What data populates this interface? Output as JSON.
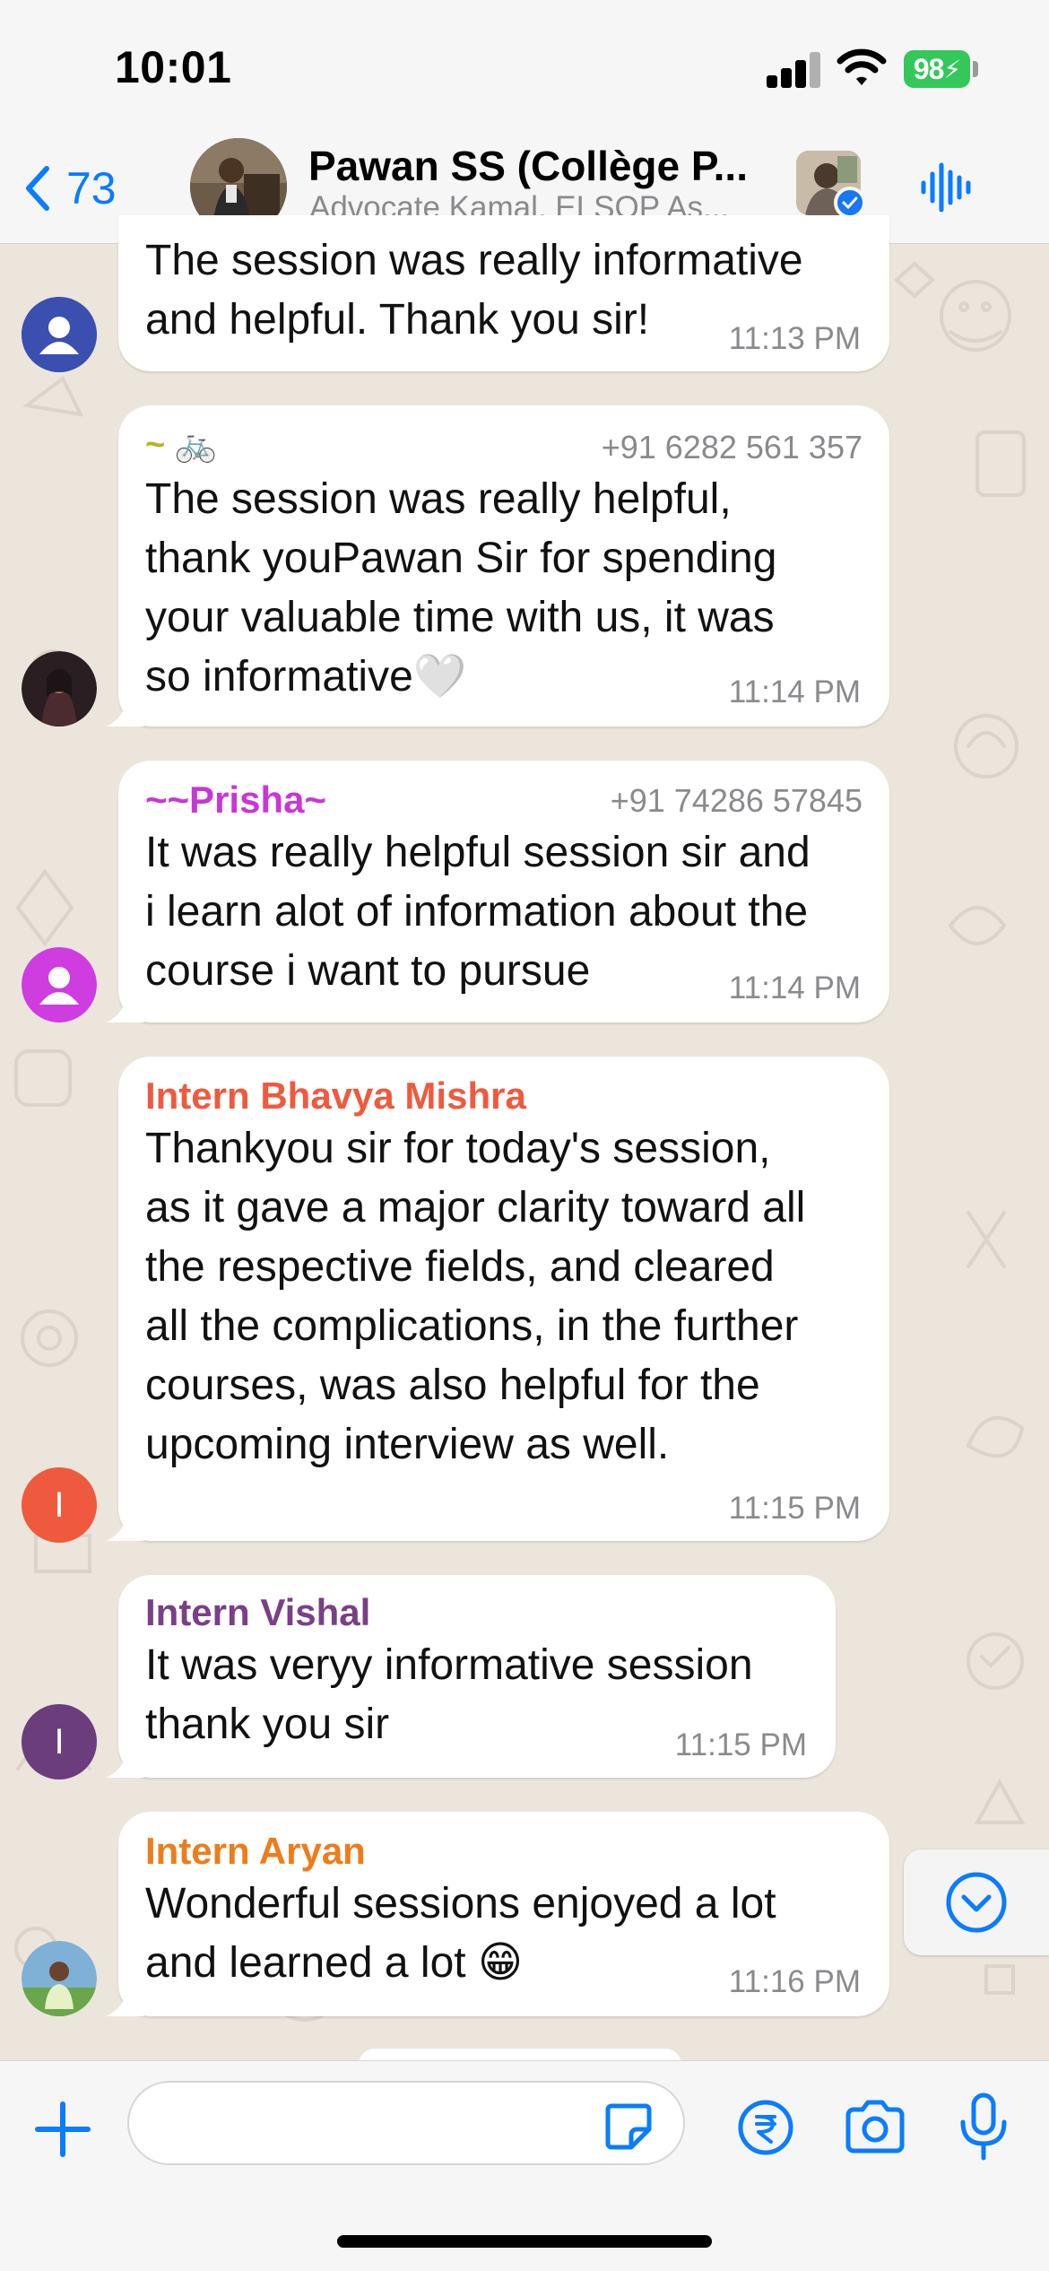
{
  "status_bar": {
    "time": "10:01",
    "battery": "98"
  },
  "header": {
    "back_count": "73",
    "title": "Pawan SS (Collège P...",
    "subtitle": "Advocate Kamal, ELSOP As..."
  },
  "messages": [
    {
      "sender": "",
      "phone": "",
      "text": "The session was really informative\nand helpful. Thank you sir!",
      "time": "11:13 PM",
      "sender_color": ""
    },
    {
      "sender": "~ 🚲",
      "phone": "+91 6282 561 357",
      "text": "The session was really helpful,\nthank youPawan Sir for spending\nyour valuable time with us, it was\nso informative🤍",
      "time": "11:14 PM",
      "sender_color": "#b5b51a"
    },
    {
      "sender": "~~Prisha~",
      "phone": "+91 74286 57845",
      "text": "It was really helpful session sir and\ni learn alot of information about the\ncourse i want to pursue",
      "time": "11:14 PM",
      "sender_color": "#c837d6"
    },
    {
      "sender": "Intern Bhavya Mishra",
      "phone": "",
      "text": "Thankyou sir for today's session,\nas it gave a major clarity toward all\nthe respective fields, and cleared\nall the complications, in the further\ncourses, was also helpful for the\nupcoming interview as well.",
      "time": "11:15 PM",
      "sender_color": "#ef5a3e"
    },
    {
      "sender": "Intern Vishal",
      "phone": "",
      "text": "It was veryy informative session\nthank  you sir",
      "time": "11:15 PM",
      "sender_color": "#7a3f86"
    },
    {
      "sender": "Intern Aryan",
      "phone": "",
      "text": "Wonderful sessions enjoyed a lot\nand learned a lot 😁",
      "time": "11:16 PM",
      "sender_color": "#ed7c1c"
    }
  ],
  "avatars": {
    "bhavya_initial": "I",
    "vishal_initial": "I"
  },
  "colors": {
    "accent": "#0a7cff",
    "bubble": "#ffffff",
    "wallpaper": "#ebe5dc",
    "battery": "#34c759"
  }
}
